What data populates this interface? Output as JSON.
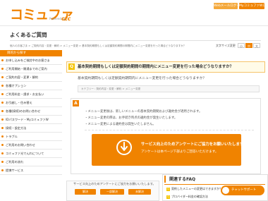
{
  "header": {
    "logo": "コミュファ",
    "logo_sub": "Powered by",
    "logo_ctc": "ctc",
    "btn_web_mail": "Webメールログイン",
    "btn_my": "MyコミュファWログイン"
  },
  "page": {
    "title": "よくあるご質問",
    "breadcrumb": "個人のお客さま > ご契約内容・変更・解約 > メニュー変更 > 基本契約期間もしくは定額契約期間の期間内にメニュー変更を行った場合どうなりますか？",
    "text_size_label": "文字サイズ変更",
    "text_sizes": [
      "小",
      "中",
      "大"
    ]
  },
  "sidebar": {
    "heading": "目的から探す",
    "items": [
      "お申し込みをご検討中のお客さま",
      "ご利用開始・開通までのご案内",
      "ご契約内容・変更・解約",
      "各種オプション",
      "ご利用料金・請求・お支払い",
      "お引越し・住み替え",
      "各種(接続)のお問い合わせ",
      "IDパスワード・MyコミュファW",
      "接続・設定方法",
      "トラブル",
      "ご利用のお問い合わせ",
      "コミュファ光でんわについて",
      "ご利用の流れ",
      "提携サービス"
    ]
  },
  "question": {
    "badge": "Q",
    "title": "基本契約期間もしくは定額契約期間の期間内にメニュー変更を行った場合どうなりますか？",
    "sub": "基本契約期間もしくは定額契約期間内にメニュー変更を行った場合どうなりますか？",
    "category": "カテゴリー : 契約内容・変更・解約 > メニュー変更"
  },
  "answer": {
    "badge": "A",
    "lines": [
      "・メニュー変更後は、新しいメニューの基本契約期間および違約金が適用されます。",
      "・メニュー変更の際は、お手続き時点の違約金が発生いたします。",
      "・メニュー変更による違約金は発生いたしません。"
    ]
  },
  "banner": {
    "line1": "サービス向上のためアンケートにご協力をお願いいたします。",
    "line2": "アンケートは本ページ下部よりご回答いただけます。"
  },
  "survey": {
    "question": "サービス向上のためアンケートにご協力をお願いいたします。",
    "buttons": [
      "解決",
      "一部解決",
      "未解決"
    ]
  },
  "related_faq": {
    "title": "関連するFAQ",
    "items": [
      "契約したメニューの変更はできますか？",
      "プロバイダー料金の確認方法"
    ]
  },
  "chat": {
    "label": "チャットサポート"
  }
}
